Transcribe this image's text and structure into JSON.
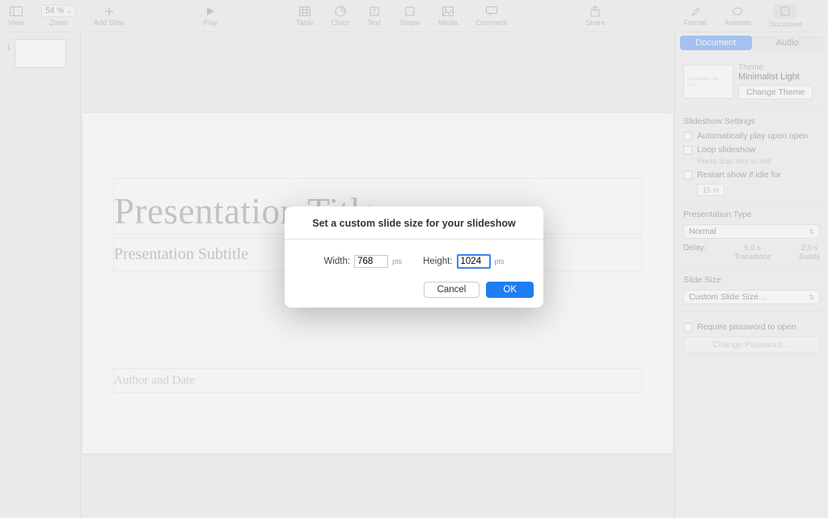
{
  "toolbar": {
    "view": "View",
    "zoom": "Zoom",
    "zoom_value": "54 %",
    "add_slide": "Add Slide",
    "play": "Play",
    "table": "Table",
    "chart": "Chart",
    "text": "Text",
    "shape": "Shape",
    "media": "Media",
    "comment": "Comment",
    "share": "Share",
    "format": "Format",
    "animate": "Animate",
    "document": "Document"
  },
  "slidenav": {
    "num": "1"
  },
  "slide": {
    "title": "Presentation Title",
    "subtitle": "Presentation Subtitle",
    "author": "Author and Date"
  },
  "inspector": {
    "tab_document": "Document",
    "tab_audio": "Audio",
    "theme_label": "Theme",
    "theme_name": "Minimalist Light",
    "change_theme": "Change Theme",
    "slideshow_settings": "Slideshow Settings",
    "auto_play": "Automatically play upon open",
    "loop": "Loop slideshow",
    "loop_hint": "Press 'Esc' key to exit",
    "restart_idle": "Restart show if idle for",
    "idle_value": "15 m",
    "presentation_type": "Presentation Type",
    "type_value": "Normal",
    "delay_label": "Delay:",
    "delay_transitions_val": "5,0 s",
    "delay_transitions": "Transitions",
    "delay_builds_val": "2,0 s",
    "delay_builds": "Builds",
    "slide_size": "Slide Size",
    "slide_size_value": "Custom Slide Size…",
    "require_password": "Require password to open",
    "change_password": "Change Password…"
  },
  "modal": {
    "title": "Set a custom slide size for your slideshow",
    "width_label": "Width:",
    "width_value": "768",
    "height_label": "Height:",
    "height_value": "1024",
    "unit": "pts",
    "cancel": "Cancel",
    "ok": "OK"
  }
}
